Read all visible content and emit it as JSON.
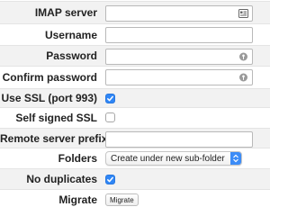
{
  "rows": {
    "imap_server": {
      "label": "IMAP server",
      "value": ""
    },
    "username": {
      "label": "Username",
      "value": ""
    },
    "password": {
      "label": "Password",
      "value": ""
    },
    "confirm_password": {
      "label": "Confirm password",
      "value": ""
    },
    "use_ssl": {
      "label": "Use SSL (port 993)",
      "checked": true
    },
    "self_signed_ssl": {
      "label": "Self signed SSL",
      "checked": false
    },
    "remote_server_prefix": {
      "label": "Remote server prefix",
      "value": ""
    },
    "folders": {
      "label": "Folders",
      "selected": "Create under new sub-folder"
    },
    "no_duplicates": {
      "label": "No duplicates",
      "checked": true
    },
    "migrate": {
      "label": "Migrate",
      "button_label": "Migrate"
    }
  },
  "colors": {
    "accent": "#2f86f6",
    "row_alt": "#f2f2f2"
  },
  "icons": {
    "imap_server": "address-card-icon",
    "password": "key-icon",
    "checkbox_checked": "checkmark-icon",
    "select": "select-arrows-icon"
  }
}
